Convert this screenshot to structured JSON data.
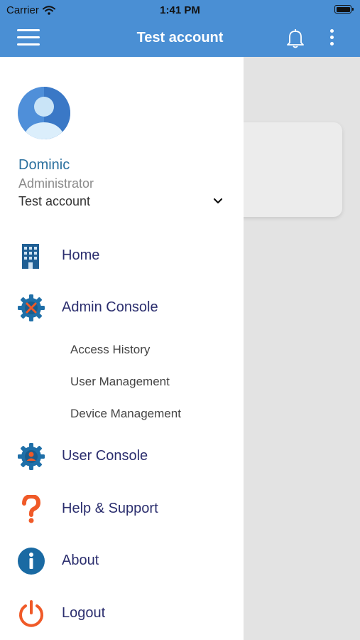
{
  "status_bar": {
    "carrier": "Carrier",
    "time": "1:41 PM"
  },
  "nav": {
    "title": "Test account"
  },
  "profile": {
    "name": "Dominic",
    "role": "Administrator",
    "account": "Test account"
  },
  "menu": {
    "home": "Home",
    "admin_console": "Admin Console",
    "admin_sub": {
      "access_history": "Access History",
      "user_management": "User Management",
      "device_management": "Device Management"
    },
    "user_console": "User Console",
    "help_support": "Help & Support",
    "about": "About",
    "logout": "Logout"
  },
  "colors": {
    "header": "#4a8fd4",
    "gear": "#1f6fa8",
    "question": "#f05a28",
    "logout": "#f05a28",
    "label": "#2b2e6e"
  }
}
